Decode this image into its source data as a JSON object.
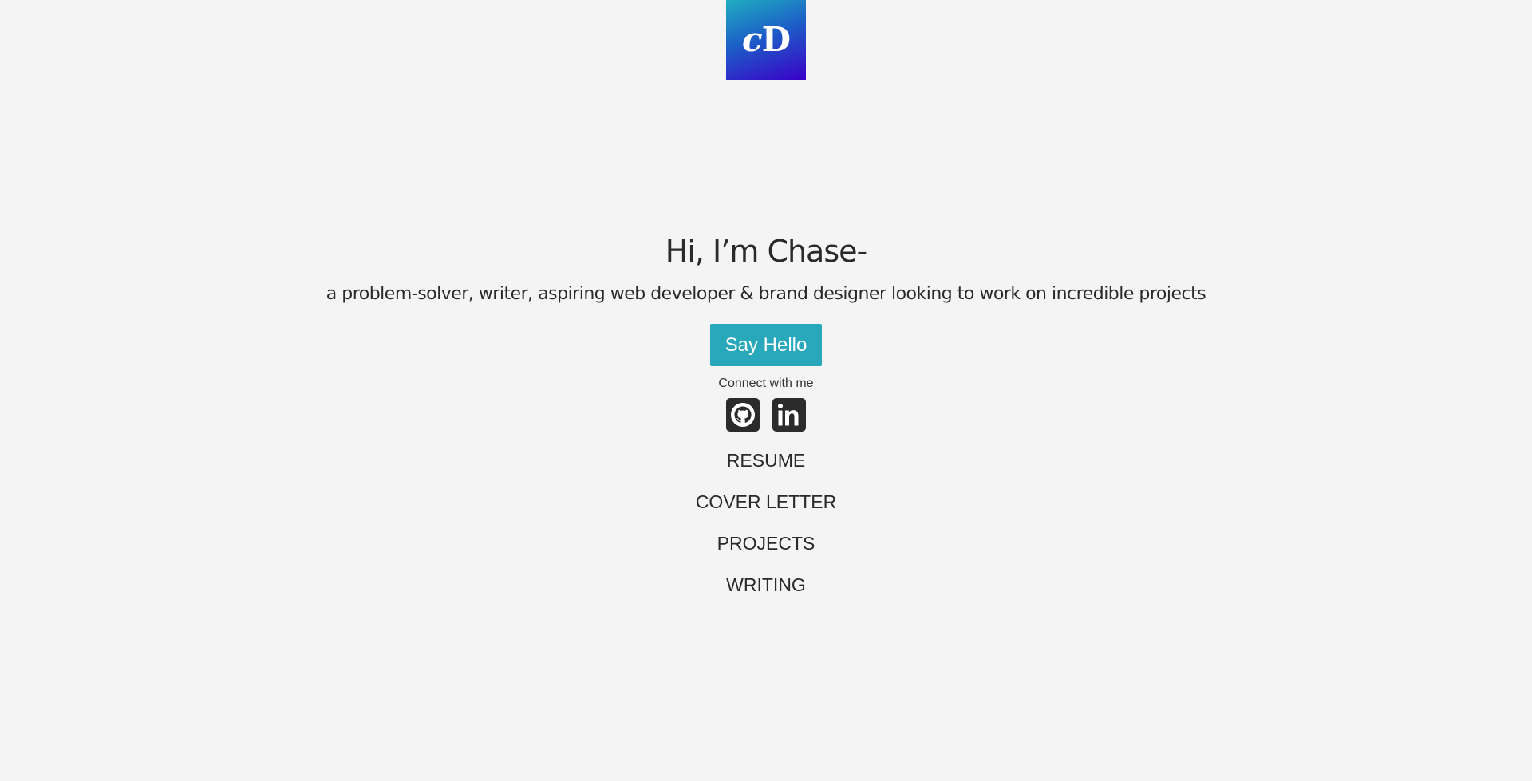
{
  "logo": {
    "text_lower": "c",
    "text_upper": "D",
    "colors": [
      "#20aec0",
      "#1c5fc7",
      "#3a00c8"
    ]
  },
  "hero": {
    "headline": "Hi, I’m Chase-",
    "tagline": "a problem-solver, writer, aspiring web developer & brand designer looking to work on incredible projects",
    "cta_label": "Say Hello",
    "cta_color": "#29a8bb"
  },
  "connect": {
    "label": "Connect with me",
    "links": [
      {
        "icon": "github-icon"
      },
      {
        "icon": "linkedin-icon"
      }
    ]
  },
  "nav": {
    "items": [
      "RESUME",
      "COVER LETTER",
      "PROJECTS",
      "WRITING"
    ]
  },
  "colors": {
    "background": "#f4f4f4",
    "text": "#2a2a2a",
    "icon_bg": "#2b2b2b"
  }
}
